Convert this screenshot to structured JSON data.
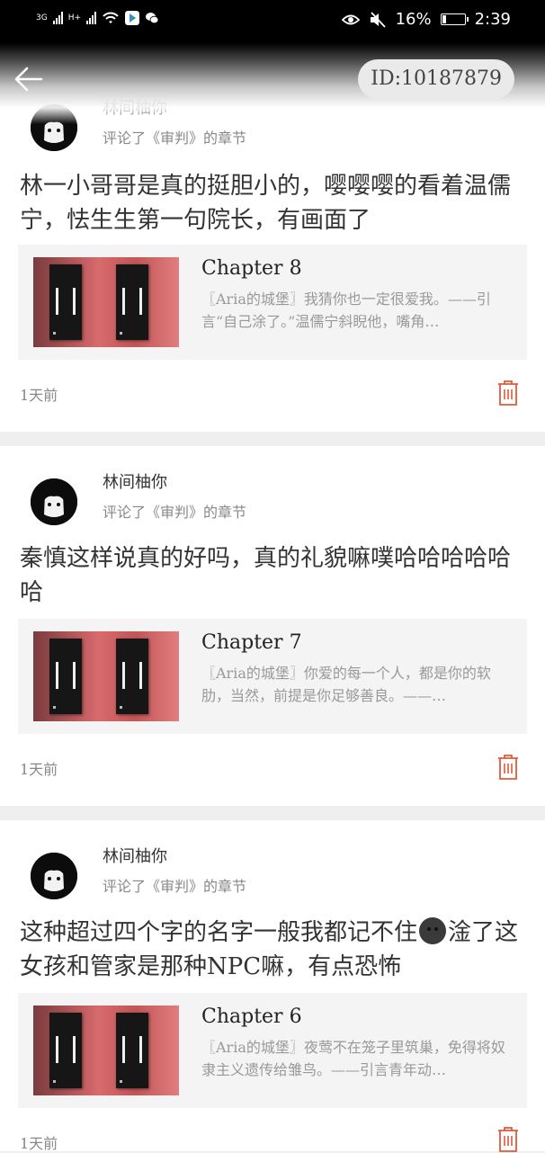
{
  "status_bar": {
    "network_1": "3G",
    "network_2": "H+",
    "battery_percent": "16%",
    "battery_level": 0.16,
    "time": "2:39",
    "icons": [
      "signal-icon",
      "signal-icon",
      "wifi-icon",
      "play-store-icon",
      "wechat-icon",
      "eye-icon",
      "mute-icon",
      "battery-icon"
    ]
  },
  "header": {
    "back_icon": "back-arrow-icon",
    "id_label": "ID:10187879"
  },
  "comments": [
    {
      "username": "林间柚你",
      "subline": "评论了《审判》的章节",
      "text": "林一小哥哥是真的挺胆小的，嘤嘤嘤的看着温儒宁，怯生生第一句院长，有画面了",
      "chapter_title": "Chapter 8",
      "excerpt": "〖Aria的城堡〗我猜你也一定很爱我。——引言“自己涂了。”温儒宁斜睨他，嘴角…",
      "time": "1天前"
    },
    {
      "username": "林间柚你",
      "subline": "评论了《审判》的章节",
      "text": "秦慎这样说真的好吗，真的礼貌嘛噗哈哈哈哈哈哈",
      "chapter_title": "Chapter 7",
      "excerpt": "〖Aria的城堡〗你爱的每一个人，都是你的软肋，当然，前提是你足够善良。——…",
      "time": "1天前"
    },
    {
      "username": "林间柚你",
      "subline": "评论了《审判》的章节",
      "text_before_emoji": "这种超过四个字的名字一般我都记不住",
      "text_after_emoji": "淦了这女孩和管家是那种NPC嘛，有点恐怖",
      "chapter_title": "Chapter 6",
      "excerpt": "〖Aria的城堡〗夜莺不在笼子里筑巢，免得将奴隶主义遗传给雏鸟。——引言青年动…",
      "time": "1天前"
    }
  ],
  "colors": {
    "delete_icon": "#e05a3a",
    "card_bg": "#ffffff",
    "separator": "#efefef",
    "chapter_box_bg": "#f4f4f4"
  }
}
